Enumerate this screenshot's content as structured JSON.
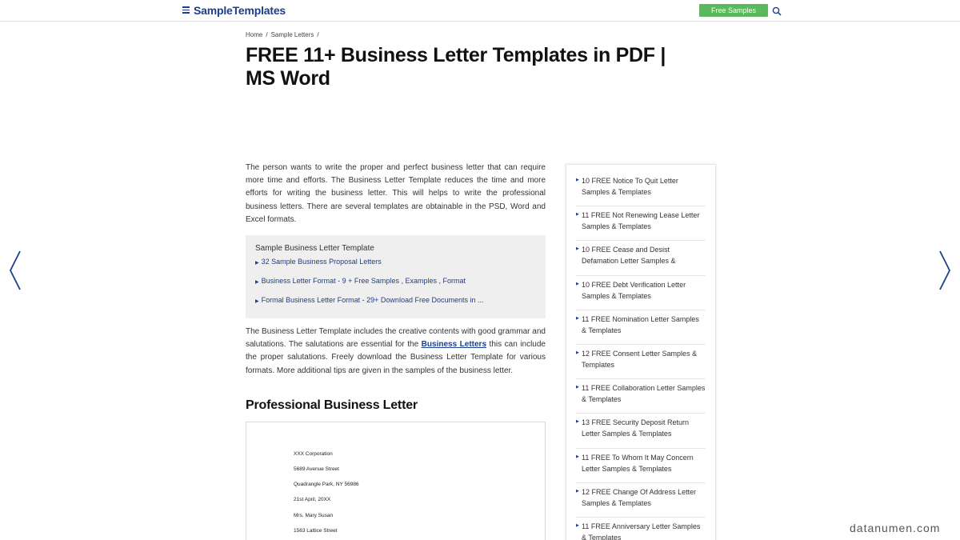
{
  "header": {
    "logo": "SampleTemplates",
    "free_button": "Free Samples"
  },
  "breadcrumb": {
    "items": [
      "Home",
      "Sample Letters"
    ],
    "separator": "/"
  },
  "page_title": "FREE 11+ Business Letter Templates in PDF | MS Word",
  "intro_paragraph": "The person wants to write the proper and perfect business letter that can require more time and efforts. The Business Letter Template reduces the time and more efforts for writing the business letter. This will helps to write the professional business letters. There are several templates are obtainable in the PSD, Word and Excel formats.",
  "toc": {
    "title": "Sample Business Letter Template",
    "links": [
      "32 Sample Business Proposal Letters",
      "Business Letter Format - 9 + Free Samples , Examples , Format",
      "Formal Business Letter Format - 29+ Download Free Documents in ..."
    ]
  },
  "second_paragraph": {
    "before_link": "The Business Letter Template includes the creative contents with good grammar and salutations. The salutations are essential for the ",
    "link": "Business Letters",
    "after_link": " this can include the proper salutations. Freely download the Business Letter Template for various formats. More additional tips are given in the samples of the business letter."
  },
  "section_title": "Professional Business Letter",
  "letter_preview": {
    "lines": [
      "XXX Corporation",
      "5689 Avenue Street",
      "Quadrangle Park, NY 56986",
      "21st April, 20XX",
      "Mrs. Mary Susan",
      "1563 Lattice Street"
    ]
  },
  "sidebar": {
    "items": [
      "10 FREE Notice To Quit Letter Samples & Templates",
      "11 FREE Not Renewing Lease Letter Samples & Templates",
      "10 FREE Cease and Desist Defamation Letter Samples &",
      "10 FREE Debt Verification Letter Samples & Templates",
      "11 FREE Nomination Letter Samples & Templates",
      "12 FREE Consent Letter Samples & Templates",
      "11 FREE Collaboration Letter Samples & Templates",
      "13 FREE Security Deposit Return Letter Samples & Templates",
      "11 FREE To Whom It May Concern Letter Samples & Templates",
      "12 FREE Change Of Address Letter Samples & Templates",
      "11 FREE Anniversary Letter Samples & Templates"
    ]
  },
  "watermark": "datanumen.com",
  "colors": {
    "brand": "#1d3e8a",
    "button_green": "#5cb85c",
    "toc_background": "#efefef"
  },
  "icons": {
    "menu": "hamburger-menu-icon",
    "search": "search-icon",
    "prev": "chevron-left-icon",
    "next": "chevron-right-icon"
  }
}
